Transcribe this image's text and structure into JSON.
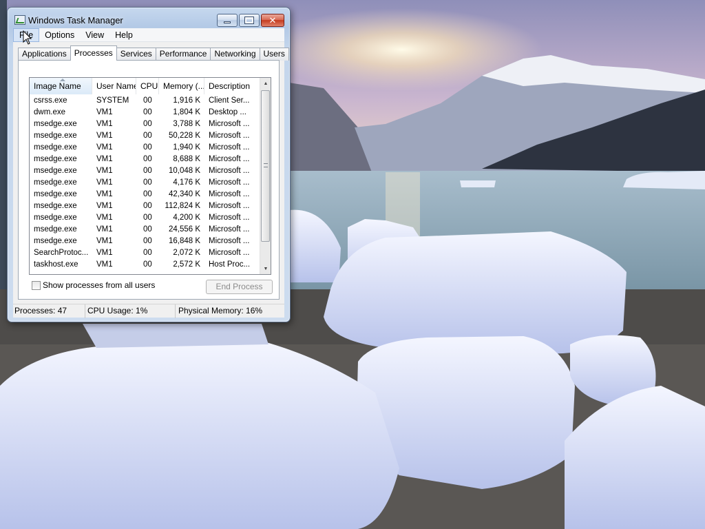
{
  "window": {
    "title": "Windows Task Manager",
    "icon": "task-manager-icon",
    "caption_buttons": [
      "minimize-icon",
      "maximize-icon",
      "close-icon"
    ]
  },
  "menu": {
    "items": [
      {
        "label": "File",
        "active": true
      },
      {
        "label": "Options"
      },
      {
        "label": "View"
      },
      {
        "label": "Help"
      }
    ]
  },
  "tabs": [
    {
      "label": "Applications"
    },
    {
      "label": "Processes",
      "selected": true
    },
    {
      "label": "Services"
    },
    {
      "label": "Performance"
    },
    {
      "label": "Networking"
    },
    {
      "label": "Users"
    }
  ],
  "processes": {
    "columns": {
      "name": "Image Name",
      "user": "User Name",
      "cpu": "CPU",
      "memory": "Memory (...",
      "description": "Description"
    },
    "rows": [
      {
        "name": "csrss.exe",
        "user": "SYSTEM",
        "cpu": "00",
        "memory": "1,916 K",
        "description": "Client Ser..."
      },
      {
        "name": "dwm.exe",
        "user": "VM1",
        "cpu": "00",
        "memory": "1,804 K",
        "description": "Desktop ..."
      },
      {
        "name": "msedge.exe",
        "user": "VM1",
        "cpu": "00",
        "memory": "3,788 K",
        "description": "Microsoft ..."
      },
      {
        "name": "msedge.exe",
        "user": "VM1",
        "cpu": "00",
        "memory": "50,228 K",
        "description": "Microsoft ..."
      },
      {
        "name": "msedge.exe",
        "user": "VM1",
        "cpu": "00",
        "memory": "1,940 K",
        "description": "Microsoft ..."
      },
      {
        "name": "msedge.exe",
        "user": "VM1",
        "cpu": "00",
        "memory": "8,688 K",
        "description": "Microsoft ..."
      },
      {
        "name": "msedge.exe",
        "user": "VM1",
        "cpu": "00",
        "memory": "10,048 K",
        "description": "Microsoft ..."
      },
      {
        "name": "msedge.exe",
        "user": "VM1",
        "cpu": "00",
        "memory": "4,176 K",
        "description": "Microsoft ..."
      },
      {
        "name": "msedge.exe",
        "user": "VM1",
        "cpu": "00",
        "memory": "42,340 K",
        "description": "Microsoft ..."
      },
      {
        "name": "msedge.exe",
        "user": "VM1",
        "cpu": "00",
        "memory": "112,824 K",
        "description": "Microsoft ..."
      },
      {
        "name": "msedge.exe",
        "user": "VM1",
        "cpu": "00",
        "memory": "4,200 K",
        "description": "Microsoft ..."
      },
      {
        "name": "msedge.exe",
        "user": "VM1",
        "cpu": "00",
        "memory": "24,556 K",
        "description": "Microsoft ..."
      },
      {
        "name": "msedge.exe",
        "user": "VM1",
        "cpu": "00",
        "memory": "16,848 K",
        "description": "Microsoft ..."
      },
      {
        "name": "SearchProtoc...",
        "user": "VM1",
        "cpu": "00",
        "memory": "2,072 K",
        "description": "Microsoft ..."
      },
      {
        "name": "taskhost.exe",
        "user": "VM1",
        "cpu": "00",
        "memory": "2,572 K",
        "description": "Host Proc..."
      }
    ]
  },
  "controls": {
    "show_all_label": "Show processes from all users",
    "show_all_checked": false,
    "end_process_label": "End Process"
  },
  "status": {
    "processes": "Processes: 47",
    "cpu": "CPU Usage: 1%",
    "memory": "Physical Memory: 16%"
  },
  "desktop": {
    "wallpaper": "glacier-lake-sunset-wallpaper"
  }
}
